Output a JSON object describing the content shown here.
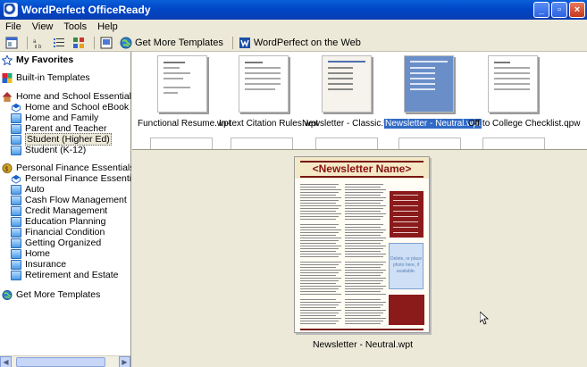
{
  "window": {
    "title": "WordPerfect OfficeReady"
  },
  "menu": [
    "File",
    "View",
    "Tools",
    "Help"
  ],
  "toolbar": {
    "get_more_templates": "Get More Templates",
    "wordperfect_on_web": "WordPerfect on the Web"
  },
  "sidebar": {
    "my_favorites": "My Favorites",
    "built_in": "Built-in Templates",
    "home_school": "Home and School Essentials",
    "home_school_items": [
      "Home and School eBook",
      "Home and Family",
      "Parent and Teacher",
      "Student (Higher Ed)",
      "Student (K-12)"
    ],
    "personal_finance": "Personal Finance Essentials",
    "personal_finance_items": [
      "Personal Finance Essentials eBook",
      "Auto",
      "Cash Flow Management",
      "Credit Management",
      "Education Planning",
      "Financial Condition",
      "Getting Organized",
      "Home",
      "Insurance",
      "Retirement and Estate"
    ],
    "get_more": "Get More Templates"
  },
  "thumbnails": [
    "Functional Resume.wpt",
    "In-text Citation Rules.wpt",
    "Newsletter - Classic.wpt",
    "Newsletter - Neutral.wpt",
    "Off to College Checklist.qpw"
  ],
  "preview": {
    "newsletter_title": "<Newsletter Name>",
    "photo_text": "Delete, or place photo here, if available.",
    "file_label": "Newsletter - Neutral.wpt"
  },
  "colors": {
    "titlebar": "#0046c8",
    "selection": "#316ac5",
    "newsletter_accent": "#8b1a1a"
  }
}
